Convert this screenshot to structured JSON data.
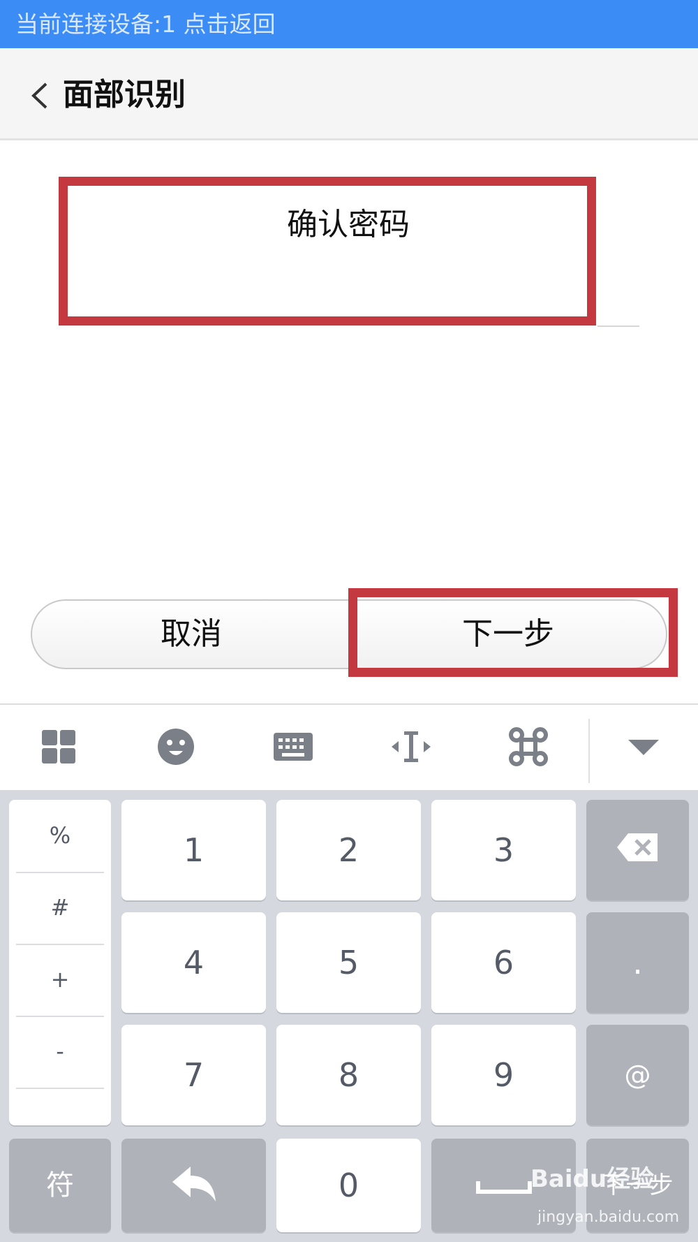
{
  "status_bar": {
    "text": "当前连接设备:1  点击返回"
  },
  "header": {
    "title": "面部识别"
  },
  "form": {
    "field_label": "确认密码"
  },
  "actions": {
    "cancel_label": "取消",
    "next_label": "下一步"
  },
  "keyboard": {
    "toolbar": [
      "apps-grid-icon",
      "emoji-icon",
      "keyboard-icon",
      "cursor-move-icon",
      "command-icon",
      "collapse-keyboard-icon"
    ],
    "symbols": [
      "%",
      "#",
      "+",
      "-"
    ],
    "row1": [
      "1",
      "2",
      "3"
    ],
    "row2": [
      "4",
      "5",
      "6"
    ],
    "row3": [
      "7",
      "8",
      "9"
    ],
    "dot": ".",
    "at": "@",
    "symbol_key": "符",
    "zero": "0",
    "next_key": "下一步"
  },
  "watermark": {
    "brand": "Baidu经验",
    "url": "jingyan.baidu.com"
  },
  "colors": {
    "status_bar": "#3b8cf5",
    "highlight": "#c3393f",
    "keyboard_bg": "#d5d8de"
  }
}
